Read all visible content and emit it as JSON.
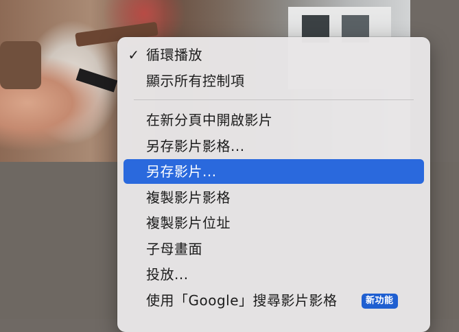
{
  "menu": {
    "items": [
      {
        "label": "循環播放",
        "checked": true
      },
      {
        "label": "顯示所有控制項",
        "checked": false
      },
      {
        "label": "在新分頁中開啟影片",
        "checked": false
      },
      {
        "label": "另存影片影格...",
        "checked": false
      },
      {
        "label": "另存影片...",
        "checked": false,
        "highlighted": true
      },
      {
        "label": "複製影片影格",
        "checked": false
      },
      {
        "label": "複製影片位址",
        "checked": false
      },
      {
        "label": "子母畫面",
        "checked": false
      },
      {
        "label": "投放...",
        "checked": false
      },
      {
        "label": "使用「Google」搜尋影片影格",
        "checked": false,
        "badge": "新功能"
      }
    ],
    "check_mark": "✓",
    "highlight_color": "#2a69dd",
    "badge_color": "#1f5fd1"
  }
}
